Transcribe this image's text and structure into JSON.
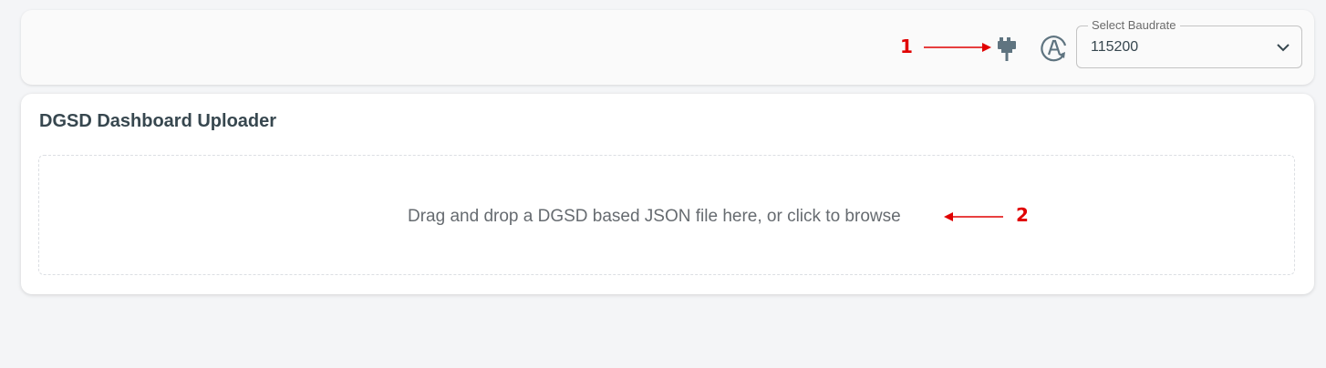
{
  "header": {
    "baudrate": {
      "label": "Select Baudrate",
      "value": "115200"
    },
    "icons": {
      "serial_connect": "serial-port-icon",
      "auto_detect": "auto-baud-icon"
    }
  },
  "uploader": {
    "title": "DGSD Dashboard Uploader",
    "dropzone_text": "Drag and drop a DGSD based JSON file here, or click to browse"
  },
  "annotations": {
    "marker_1": "1",
    "marker_2": "2",
    "color": "#e00000"
  },
  "colors": {
    "text_dark": "#37474f",
    "icon": "#5f7480",
    "background": "#f4f5f7"
  }
}
